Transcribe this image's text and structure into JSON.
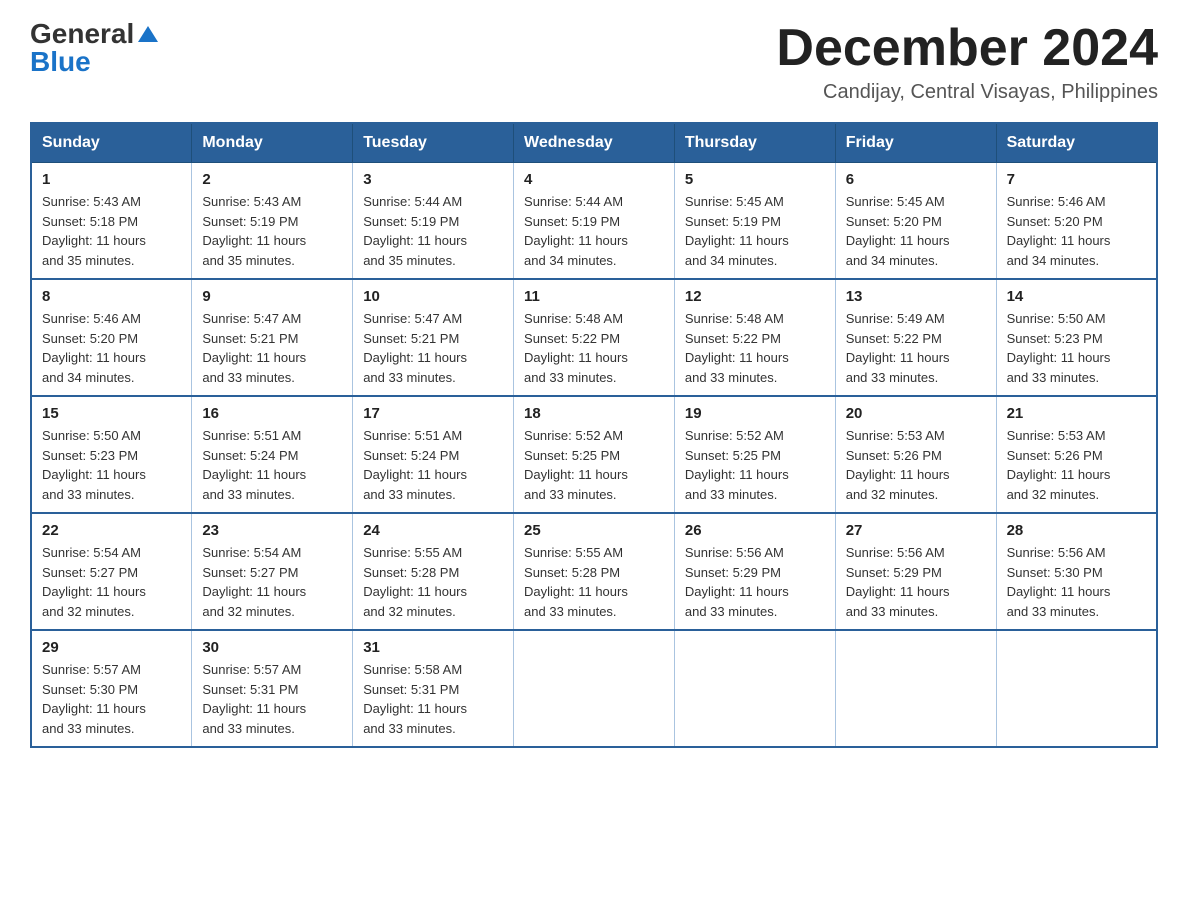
{
  "header": {
    "logo_general": "General",
    "logo_blue": "Blue",
    "month_year": "December 2024",
    "location": "Candijay, Central Visayas, Philippines"
  },
  "days_of_week": [
    "Sunday",
    "Monday",
    "Tuesday",
    "Wednesday",
    "Thursday",
    "Friday",
    "Saturday"
  ],
  "weeks": [
    [
      {
        "day": "1",
        "sunrise": "5:43 AM",
        "sunset": "5:18 PM",
        "daylight": "11 hours and 35 minutes."
      },
      {
        "day": "2",
        "sunrise": "5:43 AM",
        "sunset": "5:19 PM",
        "daylight": "11 hours and 35 minutes."
      },
      {
        "day": "3",
        "sunrise": "5:44 AM",
        "sunset": "5:19 PM",
        "daylight": "11 hours and 35 minutes."
      },
      {
        "day": "4",
        "sunrise": "5:44 AM",
        "sunset": "5:19 PM",
        "daylight": "11 hours and 34 minutes."
      },
      {
        "day": "5",
        "sunrise": "5:45 AM",
        "sunset": "5:19 PM",
        "daylight": "11 hours and 34 minutes."
      },
      {
        "day": "6",
        "sunrise": "5:45 AM",
        "sunset": "5:20 PM",
        "daylight": "11 hours and 34 minutes."
      },
      {
        "day": "7",
        "sunrise": "5:46 AM",
        "sunset": "5:20 PM",
        "daylight": "11 hours and 34 minutes."
      }
    ],
    [
      {
        "day": "8",
        "sunrise": "5:46 AM",
        "sunset": "5:20 PM",
        "daylight": "11 hours and 34 minutes."
      },
      {
        "day": "9",
        "sunrise": "5:47 AM",
        "sunset": "5:21 PM",
        "daylight": "11 hours and 33 minutes."
      },
      {
        "day": "10",
        "sunrise": "5:47 AM",
        "sunset": "5:21 PM",
        "daylight": "11 hours and 33 minutes."
      },
      {
        "day": "11",
        "sunrise": "5:48 AM",
        "sunset": "5:22 PM",
        "daylight": "11 hours and 33 minutes."
      },
      {
        "day": "12",
        "sunrise": "5:48 AM",
        "sunset": "5:22 PM",
        "daylight": "11 hours and 33 minutes."
      },
      {
        "day": "13",
        "sunrise": "5:49 AM",
        "sunset": "5:22 PM",
        "daylight": "11 hours and 33 minutes."
      },
      {
        "day": "14",
        "sunrise": "5:50 AM",
        "sunset": "5:23 PM",
        "daylight": "11 hours and 33 minutes."
      }
    ],
    [
      {
        "day": "15",
        "sunrise": "5:50 AM",
        "sunset": "5:23 PM",
        "daylight": "11 hours and 33 minutes."
      },
      {
        "day": "16",
        "sunrise": "5:51 AM",
        "sunset": "5:24 PM",
        "daylight": "11 hours and 33 minutes."
      },
      {
        "day": "17",
        "sunrise": "5:51 AM",
        "sunset": "5:24 PM",
        "daylight": "11 hours and 33 minutes."
      },
      {
        "day": "18",
        "sunrise": "5:52 AM",
        "sunset": "5:25 PM",
        "daylight": "11 hours and 33 minutes."
      },
      {
        "day": "19",
        "sunrise": "5:52 AM",
        "sunset": "5:25 PM",
        "daylight": "11 hours and 33 minutes."
      },
      {
        "day": "20",
        "sunrise": "5:53 AM",
        "sunset": "5:26 PM",
        "daylight": "11 hours and 32 minutes."
      },
      {
        "day": "21",
        "sunrise": "5:53 AM",
        "sunset": "5:26 PM",
        "daylight": "11 hours and 32 minutes."
      }
    ],
    [
      {
        "day": "22",
        "sunrise": "5:54 AM",
        "sunset": "5:27 PM",
        "daylight": "11 hours and 32 minutes."
      },
      {
        "day": "23",
        "sunrise": "5:54 AM",
        "sunset": "5:27 PM",
        "daylight": "11 hours and 32 minutes."
      },
      {
        "day": "24",
        "sunrise": "5:55 AM",
        "sunset": "5:28 PM",
        "daylight": "11 hours and 32 minutes."
      },
      {
        "day": "25",
        "sunrise": "5:55 AM",
        "sunset": "5:28 PM",
        "daylight": "11 hours and 33 minutes."
      },
      {
        "day": "26",
        "sunrise": "5:56 AM",
        "sunset": "5:29 PM",
        "daylight": "11 hours and 33 minutes."
      },
      {
        "day": "27",
        "sunrise": "5:56 AM",
        "sunset": "5:29 PM",
        "daylight": "11 hours and 33 minutes."
      },
      {
        "day": "28",
        "sunrise": "5:56 AM",
        "sunset": "5:30 PM",
        "daylight": "11 hours and 33 minutes."
      }
    ],
    [
      {
        "day": "29",
        "sunrise": "5:57 AM",
        "sunset": "5:30 PM",
        "daylight": "11 hours and 33 minutes."
      },
      {
        "day": "30",
        "sunrise": "5:57 AM",
        "sunset": "5:31 PM",
        "daylight": "11 hours and 33 minutes."
      },
      {
        "day": "31",
        "sunrise": "5:58 AM",
        "sunset": "5:31 PM",
        "daylight": "11 hours and 33 minutes."
      },
      null,
      null,
      null,
      null
    ]
  ],
  "labels": {
    "sunrise": "Sunrise:",
    "sunset": "Sunset:",
    "daylight": "Daylight:"
  }
}
